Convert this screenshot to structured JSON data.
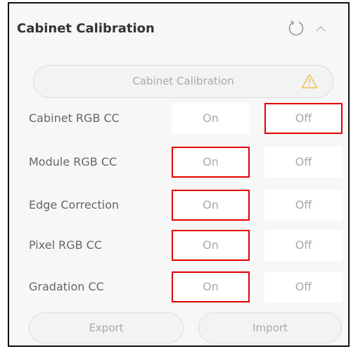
{
  "panel": {
    "title": "Cabinet Calibration",
    "icons": {
      "refresh": "refresh-icon",
      "collapse": "chevron-up-icon",
      "warning": "warning-icon"
    }
  },
  "calibration_button": {
    "label": "Cabinet Calibration"
  },
  "rows": [
    {
      "label": "Cabinet RGB CC",
      "on": "On",
      "off": "Off"
    },
    {
      "label": "Module RGB CC",
      "on": "On",
      "off": "Off"
    },
    {
      "label": "Edge Correction",
      "on": "On",
      "off": "Off"
    },
    {
      "label": "Pixel RGB CC",
      "on": "On",
      "off": "Off"
    },
    {
      "label": "Gradation CC",
      "on": "On",
      "off": "Off"
    }
  ],
  "footer": {
    "export_label": "Export",
    "import_label": "Import"
  },
  "colors": {
    "highlight": "#e60000",
    "panel_background": "#f7f7f7",
    "warning": "#f0c040"
  }
}
